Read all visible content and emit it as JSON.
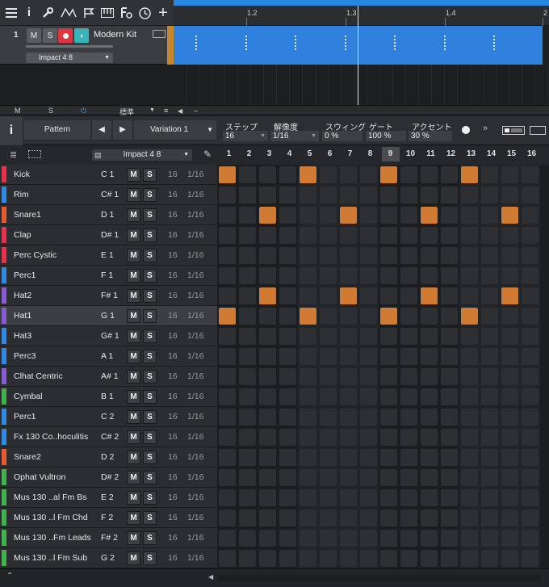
{
  "toolbar": {
    "icons": [
      "menu-icon",
      "info-icon",
      "wrench-icon",
      "automation-icon",
      "flag-icon",
      "keyboard-icon",
      "tempo-icon",
      "clock-icon",
      "add-icon"
    ]
  },
  "timeline": {
    "markers": [
      "1.2",
      "1.3",
      "1.4",
      "2"
    ]
  },
  "track": {
    "number": "1",
    "mute_label": "M",
    "solo_label": "S",
    "name": "Modern Kit",
    "instrument": "Impact 4 8"
  },
  "smallbar": {
    "m": "M",
    "s": "S",
    "mode": "標準"
  },
  "pattern_header": {
    "pattern_label": "Pattern",
    "variation_label": "Variation 1",
    "steps_label": "ステップ",
    "steps_value": "16",
    "resolution_label": "解像度",
    "resolution_value": "1/16",
    "swing_label": "スウィング",
    "swing_value": "0 %",
    "gate_label": "ゲート",
    "gate_value": "100 %",
    "accent_label": "アクセント",
    "accent_value": "30 %"
  },
  "subheader": {
    "kit": "Impact 4 8",
    "step_numbers": [
      "1",
      "2",
      "3",
      "4",
      "5",
      "6",
      "7",
      "8",
      "9",
      "10",
      "11",
      "12",
      "13",
      "14",
      "15",
      "16"
    ]
  },
  "rows": [
    {
      "name": "Kick",
      "pitch": "C 1",
      "color": "#e8314d",
      "steps": [
        1,
        5,
        9,
        13
      ]
    },
    {
      "name": "Rim",
      "pitch": "C# 1",
      "color": "#2f8ae8",
      "steps": []
    },
    {
      "name": "Snare1",
      "pitch": "D 1",
      "color": "#ea5a2a",
      "steps": [
        3,
        7,
        11,
        15
      ]
    },
    {
      "name": "Clap",
      "pitch": "D# 1",
      "color": "#e8314d",
      "steps": []
    },
    {
      "name": "Perc Cystic",
      "pitch": "E 1",
      "color": "#e8314d",
      "steps": []
    },
    {
      "name": "Perc1",
      "pitch": "F 1",
      "color": "#2f8ae8",
      "steps": []
    },
    {
      "name": "Hat2",
      "pitch": "F# 1",
      "color": "#8a5ad6",
      "steps": [
        3,
        7,
        11,
        15
      ]
    },
    {
      "name": "Hat1",
      "pitch": "G 1",
      "color": "#8a5ad6",
      "steps": [
        1,
        5,
        9,
        13
      ],
      "selected": true
    },
    {
      "name": "Hat3",
      "pitch": "G# 1",
      "color": "#2f8ae8",
      "steps": []
    },
    {
      "name": "Perc3",
      "pitch": "A 1",
      "color": "#2f8ae8",
      "steps": []
    },
    {
      "name": "Clhat Centric",
      "pitch": "A# 1",
      "color": "#8a5ad6",
      "steps": []
    },
    {
      "name": "Cymbal",
      "pitch": "B 1",
      "color": "#3fb44a",
      "steps": []
    },
    {
      "name": "Perc1",
      "pitch": "C 2",
      "color": "#2f8ae8",
      "steps": []
    },
    {
      "name": "Fx 130 Co..hoculitis",
      "pitch": "C# 2",
      "color": "#2f8ae8",
      "steps": []
    },
    {
      "name": "Snare2",
      "pitch": "D 2",
      "color": "#ea5a2a",
      "steps": []
    },
    {
      "name": "Ophat Vultron",
      "pitch": "D# 2",
      "color": "#3fb44a",
      "steps": []
    },
    {
      "name": "Mus 130 ..al Fm Bs",
      "pitch": "E 2",
      "color": "#3fb44a",
      "steps": []
    },
    {
      "name": "Mus 130 ..l Fm Chd",
      "pitch": "F 2",
      "color": "#3fb44a",
      "steps": []
    },
    {
      "name": "Mus 130 ..Fm Leads",
      "pitch": "F# 2",
      "color": "#3fb44a",
      "steps": []
    },
    {
      "name": "Mus 130 ..l Fm Sub",
      "pitch": "G 2",
      "color": "#3fb44a",
      "steps": []
    }
  ],
  "row_defaults": {
    "mute": "M",
    "solo": "S",
    "steps": "16",
    "resolution": "1/16"
  },
  "colors": {
    "accent_blue": "#2a86e0",
    "step_on": "#d17a34",
    "track_strip": "#c8862f"
  }
}
